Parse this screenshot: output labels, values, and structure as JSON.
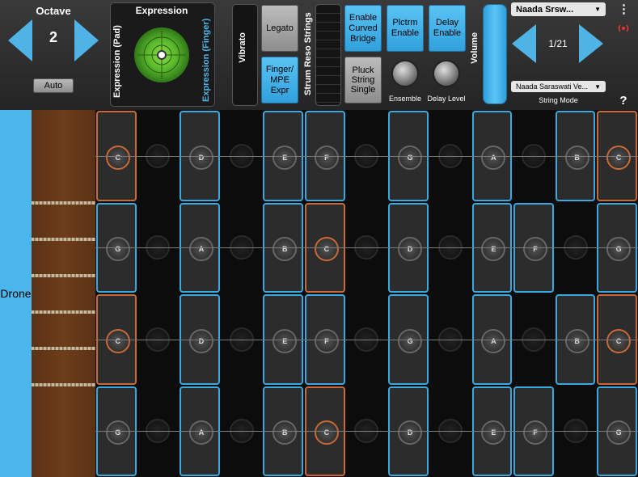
{
  "octave": {
    "title": "Octave",
    "value": "2",
    "auto_label": "Auto"
  },
  "expression": {
    "title": "Expression",
    "pad_label": "Expression (Pad)",
    "finger_label": "Expression (Finger)"
  },
  "vibrato_label": "Vibrato",
  "legato_label": "Legato",
  "finger_mpe_label": "Finger/ MPE Expr",
  "strum_reso_label": "Strum Reso Strings",
  "curved_bridge_label": "Enable Curved Bridge",
  "plctrm_label": "Plctrm Enable",
  "delay_enable_label": "Delay Enable",
  "pluck_label": "Pluck String Single",
  "ensemble_label": "Ensemble",
  "delay_level_label": "Delay Level",
  "volume_label": "Volume",
  "preset": {
    "name": "Naada Srsw...",
    "counter": "1/21"
  },
  "string_mode": {
    "value": "Naada Saraswati Ve...",
    "label": "String Mode"
  },
  "more_icon": "⋮",
  "help_label": "?",
  "drone_label": "Drone",
  "colors": {
    "accent": "#4fb3e6",
    "root": "#c96a36",
    "wood": "#6d3d1a"
  },
  "grid": {
    "rows": [
      [
        "C",
        "",
        "D",
        "",
        "E",
        "F",
        "",
        "G",
        "",
        "A",
        "",
        "B",
        "C"
      ],
      [
        "G",
        "",
        "A",
        "",
        "B",
        "C",
        "",
        "D",
        "",
        "E",
        "F",
        "",
        "G"
      ],
      [
        "C",
        "",
        "D",
        "",
        "E",
        "F",
        "",
        "G",
        "",
        "A",
        "",
        "B",
        "C"
      ],
      [
        "G",
        "",
        "A",
        "",
        "B",
        "C",
        "",
        "D",
        "",
        "E",
        "F",
        "",
        "G"
      ]
    ],
    "lit": [
      [
        1,
        0,
        1,
        0,
        1,
        1,
        0,
        1,
        0,
        1,
        0,
        1,
        1
      ],
      [
        1,
        0,
        1,
        0,
        1,
        1,
        0,
        1,
        0,
        1,
        1,
        0,
        1
      ],
      [
        1,
        0,
        1,
        0,
        1,
        1,
        0,
        1,
        0,
        1,
        0,
        1,
        1
      ],
      [
        1,
        0,
        1,
        0,
        1,
        1,
        0,
        1,
        0,
        1,
        1,
        0,
        1
      ]
    ],
    "root_note": "C"
  }
}
